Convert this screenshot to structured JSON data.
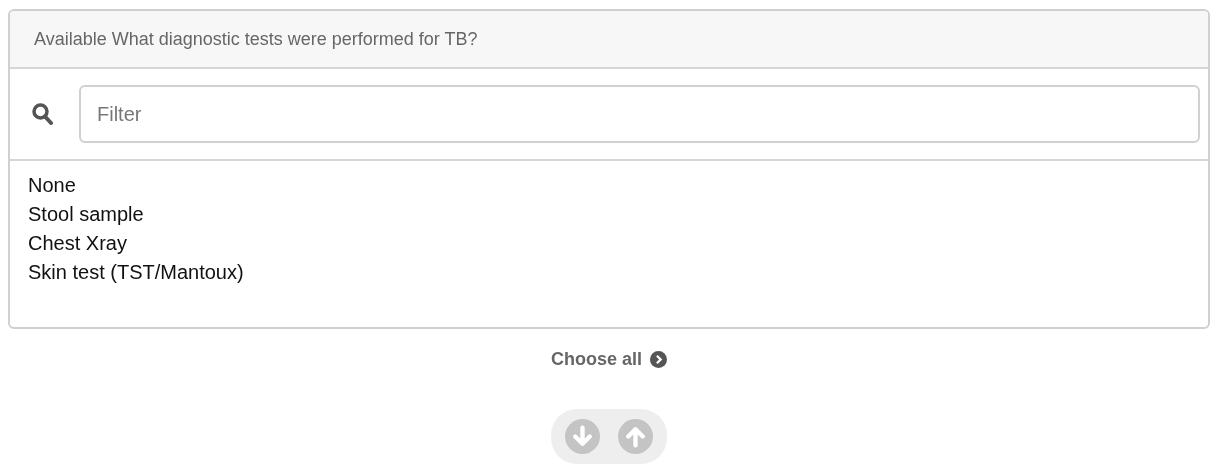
{
  "panel": {
    "title": "Available What diagnostic tests were performed for TB?"
  },
  "filter": {
    "placeholder": "Filter"
  },
  "options": [
    {
      "label": "None"
    },
    {
      "label": "Stool sample"
    },
    {
      "label": "Chest Xray"
    },
    {
      "label": "Skin test (TST/Mantoux)"
    }
  ],
  "choose_all": {
    "label": "Choose all"
  },
  "move_buttons": [
    {
      "kind": "down",
      "disabled": true
    },
    {
      "kind": "up",
      "disabled": true
    }
  ]
}
